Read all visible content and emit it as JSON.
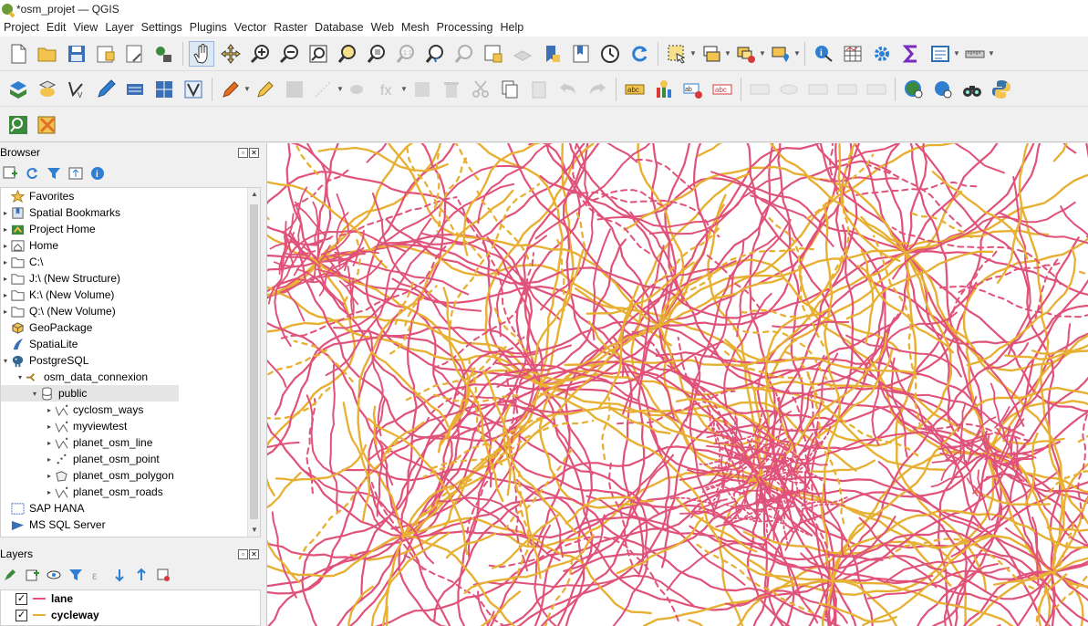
{
  "window": {
    "title": "*osm_projet — QGIS"
  },
  "menu": [
    "Project",
    "Edit",
    "View",
    "Layer",
    "Settings",
    "Plugins",
    "Vector",
    "Raster",
    "Database",
    "Web",
    "Mesh",
    "Processing",
    "Help"
  ],
  "browser": {
    "title": "Browser",
    "items": [
      {
        "label": "Favorites",
        "icon": "star-icon",
        "level": 0,
        "arrow": ""
      },
      {
        "label": "Spatial Bookmarks",
        "icon": "bookmark-icon",
        "level": 0,
        "arrow": "▸"
      },
      {
        "label": "Project Home",
        "icon": "project-home-icon",
        "level": 0,
        "arrow": "▸"
      },
      {
        "label": "Home",
        "icon": "home-folder-icon",
        "level": 0,
        "arrow": "▸"
      },
      {
        "label": "C:\\",
        "icon": "folder-icon",
        "level": 0,
        "arrow": "▸"
      },
      {
        "label": "J:\\ (New Structure)",
        "icon": "folder-icon",
        "level": 0,
        "arrow": "▸"
      },
      {
        "label": "K:\\ (New Volume)",
        "icon": "folder-icon",
        "level": 0,
        "arrow": "▸"
      },
      {
        "label": "Q:\\ (New Volume)",
        "icon": "folder-icon",
        "level": 0,
        "arrow": "▸"
      },
      {
        "label": "GeoPackage",
        "icon": "geopackage-icon",
        "level": 0,
        "arrow": ""
      },
      {
        "label": "SpatiaLite",
        "icon": "spatialite-icon",
        "level": 0,
        "arrow": ""
      },
      {
        "label": "PostgreSQL",
        "icon": "postgresql-icon",
        "level": 0,
        "arrow": "▾"
      },
      {
        "label": "osm_data_connexion",
        "icon": "connection-icon",
        "level": 1,
        "arrow": "▾"
      },
      {
        "label": "public",
        "icon": "schema-icon",
        "level": 2,
        "arrow": "▾",
        "selected": true
      },
      {
        "label": "cyclosm_ways",
        "icon": "line-layer-icon",
        "level": 3,
        "arrow": "▸"
      },
      {
        "label": "myviewtest",
        "icon": "line-layer-icon",
        "level": 3,
        "arrow": "▸"
      },
      {
        "label": "planet_osm_line",
        "icon": "line-layer-icon",
        "level": 3,
        "arrow": "▸"
      },
      {
        "label": "planet_osm_point",
        "icon": "point-layer-icon",
        "level": 3,
        "arrow": "▸"
      },
      {
        "label": "planet_osm_polygon",
        "icon": "polygon-layer-icon",
        "level": 3,
        "arrow": "▸"
      },
      {
        "label": "planet_osm_roads",
        "icon": "line-layer-icon",
        "level": 3,
        "arrow": "▸"
      },
      {
        "label": "SAP HANA",
        "icon": "sap-hana-icon",
        "level": 0,
        "arrow": ""
      },
      {
        "label": "MS SQL Server",
        "icon": "mssql-icon",
        "level": 0,
        "arrow": ""
      }
    ]
  },
  "layers": {
    "title": "Layers",
    "items": [
      {
        "name": "lane",
        "checked": true,
        "color": "#e0527a"
      },
      {
        "name": "cycleway",
        "checked": true,
        "color": "#e8b032"
      }
    ]
  },
  "colors": {
    "lane": "#e0527a",
    "cycleway": "#e8b032"
  }
}
